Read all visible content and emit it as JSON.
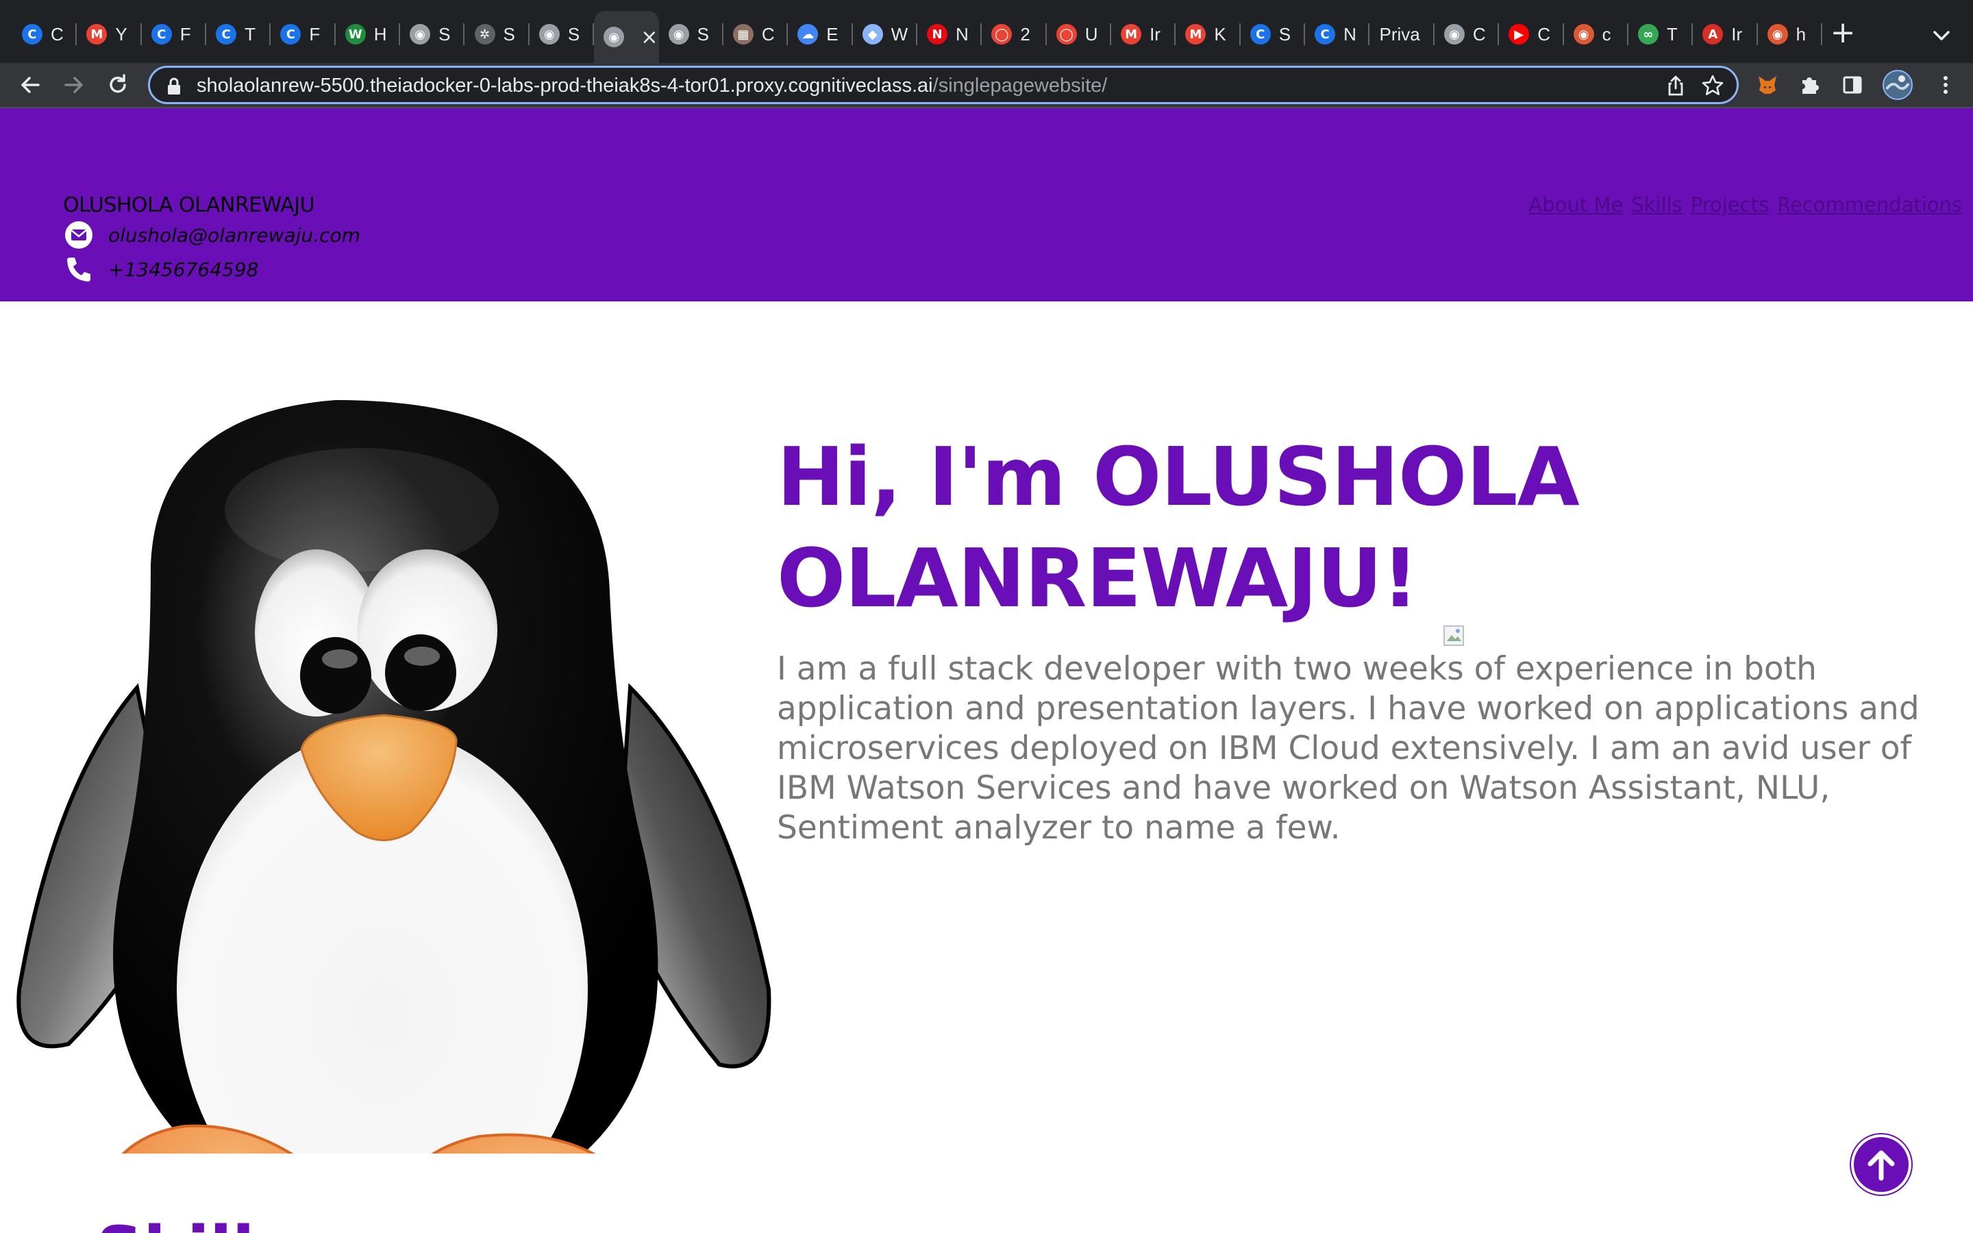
{
  "browser": {
    "tabs": [
      {
        "title": "C",
        "icon": "coursera-icon",
        "color": "#1a73e8",
        "glyph": "C"
      },
      {
        "title": "Y",
        "icon": "gmail-icon",
        "color": "#ea4335",
        "glyph": "M"
      },
      {
        "title": "F",
        "icon": "coursera-icon",
        "color": "#1a73e8",
        "glyph": "C"
      },
      {
        "title": "T",
        "icon": "coursera-icon",
        "color": "#1a73e8",
        "glyph": "C"
      },
      {
        "title": "F",
        "icon": "coursera-icon",
        "color": "#1a73e8",
        "glyph": "C"
      },
      {
        "title": "H",
        "icon": "w-icon",
        "color": "#1e8e3e",
        "glyph": "W"
      },
      {
        "title": "S",
        "icon": "globe-icon",
        "color": "#9aa0a6",
        "glyph": "◉"
      },
      {
        "title": "S",
        "icon": "gear-badge-icon",
        "color": "#5f6368",
        "glyph": "✲"
      },
      {
        "title": "S",
        "icon": "globe-icon",
        "color": "#9aa0a6",
        "glyph": "◉"
      },
      {
        "title": "",
        "icon": "globe-icon",
        "color": "#9aa0a6",
        "glyph": "◉",
        "active": true
      },
      {
        "title": "S",
        "icon": "globe-icon",
        "color": "#9aa0a6",
        "glyph": "◉"
      },
      {
        "title": "C",
        "icon": "image-icon",
        "color": "#8d6e63",
        "glyph": "▦"
      },
      {
        "title": "E",
        "icon": "cloud-icon",
        "color": "#4285f4",
        "glyph": "☁"
      },
      {
        "title": "W",
        "icon": "ticket-icon",
        "color": "#8ab4f8",
        "glyph": "◆"
      },
      {
        "title": "N",
        "icon": "netflix-icon",
        "color": "#e50914",
        "glyph": "N"
      },
      {
        "title": "2",
        "icon": "pin-icon",
        "color": "#ea4335",
        "glyph": "◯"
      },
      {
        "title": "U",
        "icon": "pin-icon",
        "color": "#ea4335",
        "glyph": "◯"
      },
      {
        "title": "Ir",
        "icon": "gmail-icon",
        "color": "#ea4335",
        "glyph": "M"
      },
      {
        "title": "K",
        "icon": "gmail-icon",
        "color": "#ea4335",
        "glyph": "M"
      },
      {
        "title": "S",
        "icon": "c-logo-icon",
        "color": "#1a73e8",
        "glyph": "C"
      },
      {
        "title": "N",
        "icon": "c-logo-icon",
        "color": "#1a73e8",
        "glyph": "C"
      },
      {
        "title": "Priva",
        "icon": "",
        "color": "",
        "glyph": ""
      },
      {
        "title": "C",
        "icon": "globe-icon",
        "color": "#9aa0a6",
        "glyph": "◉"
      },
      {
        "title": "C",
        "icon": "youtube-icon",
        "color": "#ff0000",
        "glyph": "▶"
      },
      {
        "title": "c",
        "icon": "duckduckgo-icon",
        "color": "#de5833",
        "glyph": "◉"
      },
      {
        "title": "T",
        "icon": "infinity-icon",
        "color": "#34a853",
        "glyph": "∞"
      },
      {
        "title": "Ir",
        "icon": "a-logo-icon",
        "color": "#d93025",
        "glyph": "A"
      },
      {
        "title": "h",
        "icon": "duckduckgo-icon",
        "color": "#de5833",
        "glyph": "◉"
      }
    ],
    "url_host": "sholaolanrew-5500.theiadocker-0-labs-prod-theiak8s-4-tor01.proxy.cognitiveclass.ai",
    "url_path": "/singlepagewebsite/"
  },
  "site": {
    "header": {
      "name": "OLUSHOLA OLANREWAJU",
      "email": "olushola@olanrewaju.com",
      "phone": "+13456764598"
    },
    "nav": [
      "About Me",
      "Skills",
      "Projects",
      "Recommendations"
    ],
    "hero": {
      "title": "Hi, I'm OLUSHOLA OLANREWAJU!",
      "bio": "I am a full stack developer with two weeks of experience in both application and presentation layers. I have worked on applications and microservices deployed on IBM Cloud extensively. I am an avid user of IBM Watson Services and have worked on Watson Assistant, NLU, Sentiment analyzer to name a few."
    },
    "skills_heading": "Skills"
  },
  "colors": {
    "brand_purple": "#6a0fb7",
    "nav_link": "#4c0a85",
    "bio_text": "#777777",
    "browser_dark": "#202124",
    "browser_toolbar": "#35363a",
    "focus_ring": "#8ab4f8"
  }
}
